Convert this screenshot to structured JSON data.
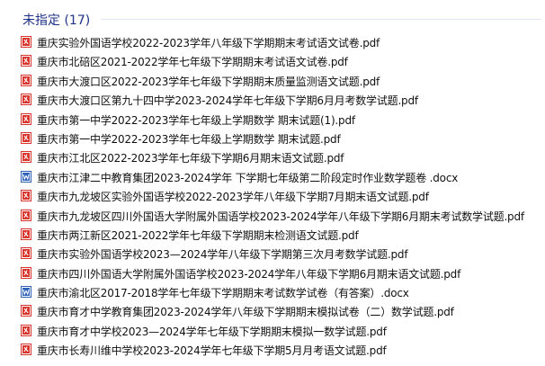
{
  "group": {
    "title": "未指定 (17)"
  },
  "icons": {
    "pdf": {
      "name": "pdf-file-icon",
      "color": "#d9342b"
    },
    "docx": {
      "name": "word-file-icon",
      "color": "#2b5fb8"
    }
  },
  "files": [
    {
      "name": "重庆实验外国语学校2022-2023学年八年级下学期期末考试语文试卷.pdf",
      "type": "pdf"
    },
    {
      "name": "重庆市北碚区2021-2022学年七年级下学期期末考试语文试卷.pdf",
      "type": "pdf"
    },
    {
      "name": "重庆市大渡口区2022-2023学年七年级下学期期末质量监测语文试题.pdf",
      "type": "pdf"
    },
    {
      "name": "重庆市大渡口区第九十四中学2023-2024学年七年级下学期6月月考数学试题.pdf",
      "type": "pdf"
    },
    {
      "name": "重庆市第一中学2022-2023学年七年级上学期数学 期末试题(1).pdf",
      "type": "pdf"
    },
    {
      "name": "重庆市第一中学2022-2023学年七年级上学期数学 期末试题.pdf",
      "type": "pdf"
    },
    {
      "name": "重庆市江北区2022-2023学年七年级下学期6月期末语文试题.pdf",
      "type": "pdf"
    },
    {
      "name": "重庆市江津二中教育集团2023-2024学年 下学期七年级第二阶段定时作业数学题卷 .docx",
      "type": "docx"
    },
    {
      "name": "重庆市九龙坡区实验外国语学校2022-2023学年八年级下学期7月期末语文试题.pdf",
      "type": "pdf"
    },
    {
      "name": "重庆市九龙坡区四川外国语大学附属外国语学校2023-2024学年八年级下学期6月期末考试数学试题.pdf",
      "type": "pdf"
    },
    {
      "name": "重庆市两江新区2021-2022学年七年级下学期期末检测语文试题.pdf",
      "type": "pdf"
    },
    {
      "name": "重庆市实验外国语学校2023—2024学年八年级下学期第三次月考数学试题.pdf",
      "type": "pdf"
    },
    {
      "name": "重庆市四川外国语大学附属外国语学校2023-2024学年八年级下学期6月期末语文试题.pdf",
      "type": "pdf"
    },
    {
      "name": "重庆市渝北区2017-2018学年七年级下学期期末考试数学试卷（有答案）.docx",
      "type": "docx"
    },
    {
      "name": "重庆市育才中学教育集团2023-2024学年八年级下学期期末模拟试卷（二）数学试题.pdf",
      "type": "pdf"
    },
    {
      "name": "重庆市育才中学校2023—2024学年七年级下学期期末模拟一数学试题.pdf",
      "type": "pdf"
    },
    {
      "name": "重庆市长寿川维中学校2023-2024学年七年级下学期5月月考语文试题.pdf",
      "type": "pdf"
    }
  ]
}
